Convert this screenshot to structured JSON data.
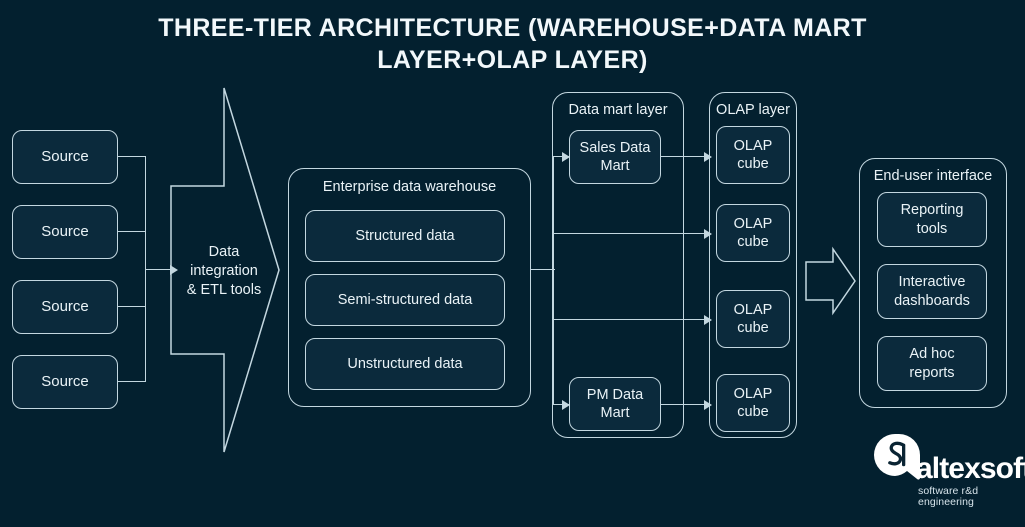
{
  "title": "THREE-TIER ARCHITECTURE (WAREHOUSE+DATA MART LAYER+OLAP LAYER)",
  "colors": {
    "background": "#03202f",
    "box_fill": "#0b2a3c",
    "stroke": "#c3d7e0",
    "text": "#eaf3f7"
  },
  "sources": [
    {
      "label": "Source"
    },
    {
      "label": "Source"
    },
    {
      "label": "Source"
    },
    {
      "label": "Source"
    }
  ],
  "etl": {
    "label": "Data\nintegration\n& ETL tools",
    "line1": "Data",
    "line2": "integration",
    "line3": "& ETL tools"
  },
  "warehouse": {
    "label": "Enterprise data warehouse",
    "items": [
      {
        "label": "Structured data"
      },
      {
        "label": "Semi-structured data"
      },
      {
        "label": "Unstructured data"
      }
    ]
  },
  "data_mart_layer": {
    "label": "Data mart layer",
    "items": [
      {
        "label": "Sales Data Mart",
        "line1": "Sales Data",
        "line2": "Mart"
      },
      {
        "label": "PM Data Mart",
        "line1": "PM Data",
        "line2": "Mart"
      }
    ]
  },
  "olap_layer": {
    "label": "OLAP layer",
    "items": [
      {
        "label": "OLAP cube",
        "line1": "OLAP",
        "line2": "cube"
      },
      {
        "label": "OLAP cube",
        "line1": "OLAP",
        "line2": "cube"
      },
      {
        "label": "OLAP cube",
        "line1": "OLAP",
        "line2": "cube"
      },
      {
        "label": "OLAP cube",
        "line1": "OLAP",
        "line2": "cube"
      }
    ]
  },
  "end_user_interface": {
    "label": "End-user interface",
    "items": [
      {
        "label": "Reporting tools",
        "line1": "Reporting",
        "line2": "tools"
      },
      {
        "label": "Interactive dashboards",
        "line1": "Interactive",
        "line2": "dashboards"
      },
      {
        "label": "Ad hoc reports",
        "line1": "Ad hoc",
        "line2": "reports"
      }
    ]
  },
  "logo": {
    "wordmark": "altexsoft",
    "tagline": "software r&d engineering",
    "mark": "altexsoft-speech-bubble-mark"
  }
}
